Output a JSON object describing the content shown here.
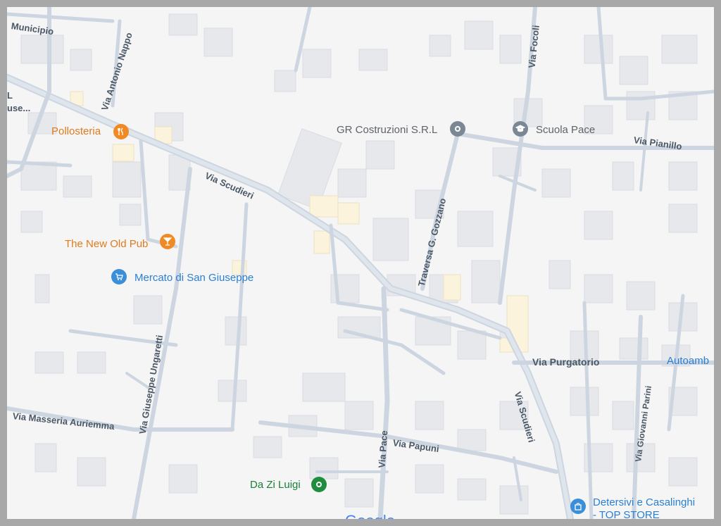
{
  "streets": {
    "municipio": "Municipio",
    "via_antonio_nappo": "Via Antonio Nappo",
    "via_scudieri_1": "Via Scudieri",
    "via_scudieri_2": "Via Scudieri",
    "via_focoli": "Via Focoli",
    "via_pianillo": "Via Pianillo",
    "traversa_gozzano": "Traversa G. Gozzano",
    "via_giuseppe_ungaretti": "Via Giuseppe Ungaretti",
    "via_masseria_auriemma": "Via Masseria Auriemma",
    "via_pace": "Via Pace",
    "via_papuni": "Via Papuni",
    "via_purgatorio": "Via Purgatorio",
    "via_giovanni_parini": "Via Giovanni Parini",
    "partial_left_1": "L",
    "partial_left_2": "use..."
  },
  "pois": {
    "pollosteria": {
      "name": "Pollosteria",
      "icon": "restaurant-icon",
      "color": "#f08a24"
    },
    "the_new_old_pub": {
      "name": "The New Old Pub",
      "icon": "bar-icon",
      "color": "#f08a24"
    },
    "mercato": {
      "name": "Mercato di San Giuseppe",
      "icon": "shopping-cart-icon",
      "color": "#3b8ed8"
    },
    "gr_costruzioni": {
      "name": "GR Costruzioni S.R.L",
      "icon": "pin-icon",
      "color": "#7b8794"
    },
    "scuola_pace": {
      "name": "Scuola Pace",
      "icon": "school-icon",
      "color": "#7b8794"
    },
    "da_zi_luigi": {
      "name": "Da Zi Luigi",
      "icon": "pin-icon",
      "color": "#1e8e3e"
    },
    "autoambulanze": {
      "name": "Autoamb",
      "icon": "",
      "color": "#3b8ed8"
    },
    "detersivi": {
      "name_line1": "Detersivi e Casalinghi",
      "name_line2": "- TOP STORE",
      "icon": "shopping-bag-icon",
      "color": "#3b8ed8"
    }
  },
  "attribution": "Google"
}
